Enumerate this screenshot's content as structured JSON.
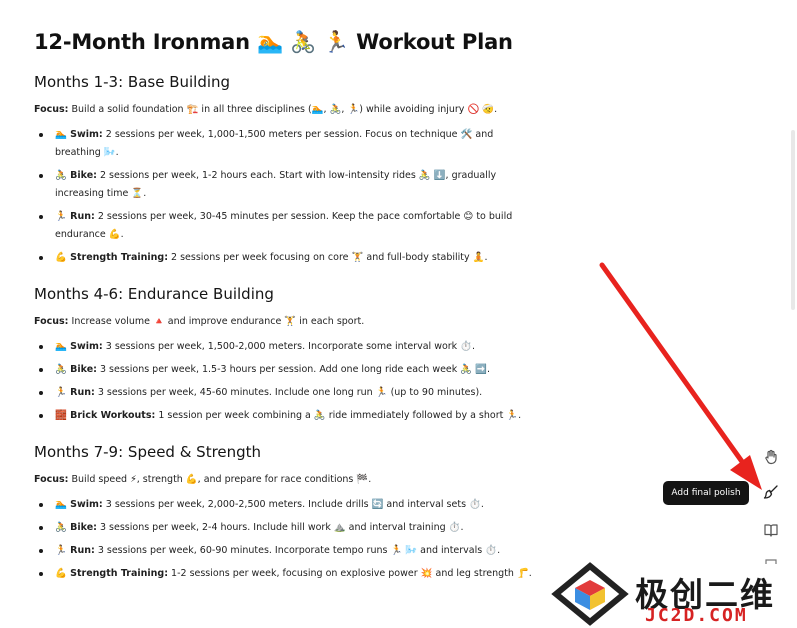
{
  "title": "12-Month Ironman 🏊 🚴 🏃 Workout Plan",
  "sections": [
    {
      "heading": "Months 1-3: Base Building",
      "focus_label": "Focus:",
      "focus_text": "Build a solid foundation 🏗️ in all three disciplines (🏊, 🚴, 🏃) while avoiding injury 🚫 🤕.",
      "items": [
        {
          "label": "🏊 Swim:",
          "text": "2 sessions per week, 1,000-1,500 meters per session. Focus on technique 🛠️ and breathing 🌬️."
        },
        {
          "label": "🚴 Bike:",
          "text": "2 sessions per week, 1-2 hours each. Start with low-intensity rides 🚴 ⬇️, gradually increasing time ⏳."
        },
        {
          "label": "🏃 Run:",
          "text": "2 sessions per week, 30-45 minutes per session. Keep the pace comfortable 😊 to build endurance 💪."
        },
        {
          "label": "💪 Strength Training:",
          "text": "2 sessions per week focusing on core 🏋️ and full-body stability 🧘."
        }
      ]
    },
    {
      "heading": "Months 4-6: Endurance Building",
      "focus_label": "Focus:",
      "focus_text": "Increase volume 🔺 and improve endurance 🏋️ in each sport.",
      "items": [
        {
          "label": "🏊 Swim:",
          "text": "3 sessions per week, 1,500-2,000 meters. Incorporate some interval work ⏱️."
        },
        {
          "label": "🚴 Bike:",
          "text": "3 sessions per week, 1.5-3 hours per session. Add one long ride each week 🚴 ➡️."
        },
        {
          "label": "🏃 Run:",
          "text": "3 sessions per week, 45-60 minutes. Include one long run 🏃 (up to 90 minutes)."
        },
        {
          "label": "🧱 Brick Workouts:",
          "text": "1 session per week combining a 🚴 ride immediately followed by a short 🏃."
        }
      ]
    },
    {
      "heading": "Months 7-9: Speed & Strength",
      "focus_label": "Focus:",
      "focus_text": "Build speed ⚡, strength 💪, and prepare for race conditions 🏁.",
      "items": [
        {
          "label": "🏊 Swim:",
          "text": "3 sessions per week, 2,000-2,500 meters. Include drills 🔄 and interval sets ⏱️."
        },
        {
          "label": "🚴 Bike:",
          "text": "3 sessions per week, 2-4 hours. Include hill work ⛰️ and interval training ⏱️."
        },
        {
          "label": "🏃 Run:",
          "text": "3 sessions per week, 60-90 minutes. Incorporate tempo runs 🏃 🌬️ and intervals ⏱️."
        },
        {
          "label": "💪 Strength Training:",
          "text": "1-2 sessions per week, focusing on explosive power 💥 and leg strength 🦵."
        }
      ]
    }
  ],
  "tooltip": "Add final polish",
  "toolbar_icons": [
    "hand-icon",
    "brush-icon",
    "book-icon"
  ],
  "annotation_color": "#e8231e",
  "watermark": {
    "main": "极创二维",
    "sub": "JC2D.COM"
  }
}
